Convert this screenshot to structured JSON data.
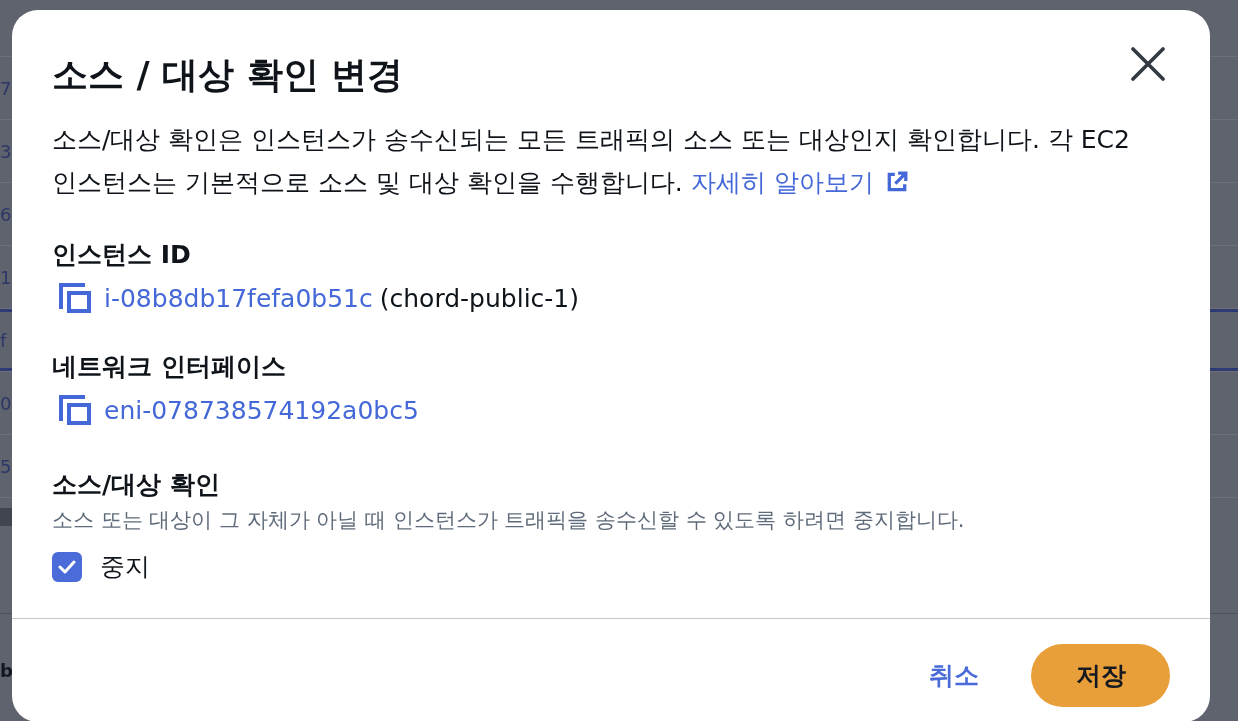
{
  "background": {
    "table": {
      "rows": [
        {
          "column_1": "7",
          "selected": false
        },
        {
          "column_1": "3",
          "selected": false
        },
        {
          "column_1": "6",
          "selected": false
        },
        {
          "column_1": "1",
          "selected": false
        },
        {
          "column_1": "f",
          "selected": true
        },
        {
          "column_1": "0",
          "selected": false
        },
        {
          "column_1": "5",
          "selected": false
        }
      ]
    },
    "footer_text": "b"
  },
  "dialog": {
    "title": "소스 / 대상 확인 변경",
    "description": "소스/대상 확인은 인스턴스가 송수신되는 모든 트래픽의 소스 또는 대상인지 확인합니다. 각 EC2 인스턴스는 기본적으로 소스 및 대상 확인을 수행합니다.",
    "learn_more_link": "자세히 알아보기",
    "fields": [
      {
        "label": "인스턴스 ID",
        "link": "i-08b8db17fefa0b51c",
        "suffix": "(chord-public-1)"
      },
      {
        "label": "네트워크 인터페이스",
        "link": "eni-078738574192a0bc5"
      }
    ],
    "source_dest_check": {
      "label": "소스/대상 확인",
      "description": "소스 또는 대상이 그 자체가 아닐 때 인스턴스가 트래픽을 송수신할 수 있도록 하려면 중지합니다.",
      "checkbox": {
        "label": "중지",
        "checked": true
      }
    },
    "buttons": [
      {
        "label": "취소",
        "kind": "link"
      },
      {
        "label": "저장",
        "kind": "primary"
      }
    ]
  }
}
